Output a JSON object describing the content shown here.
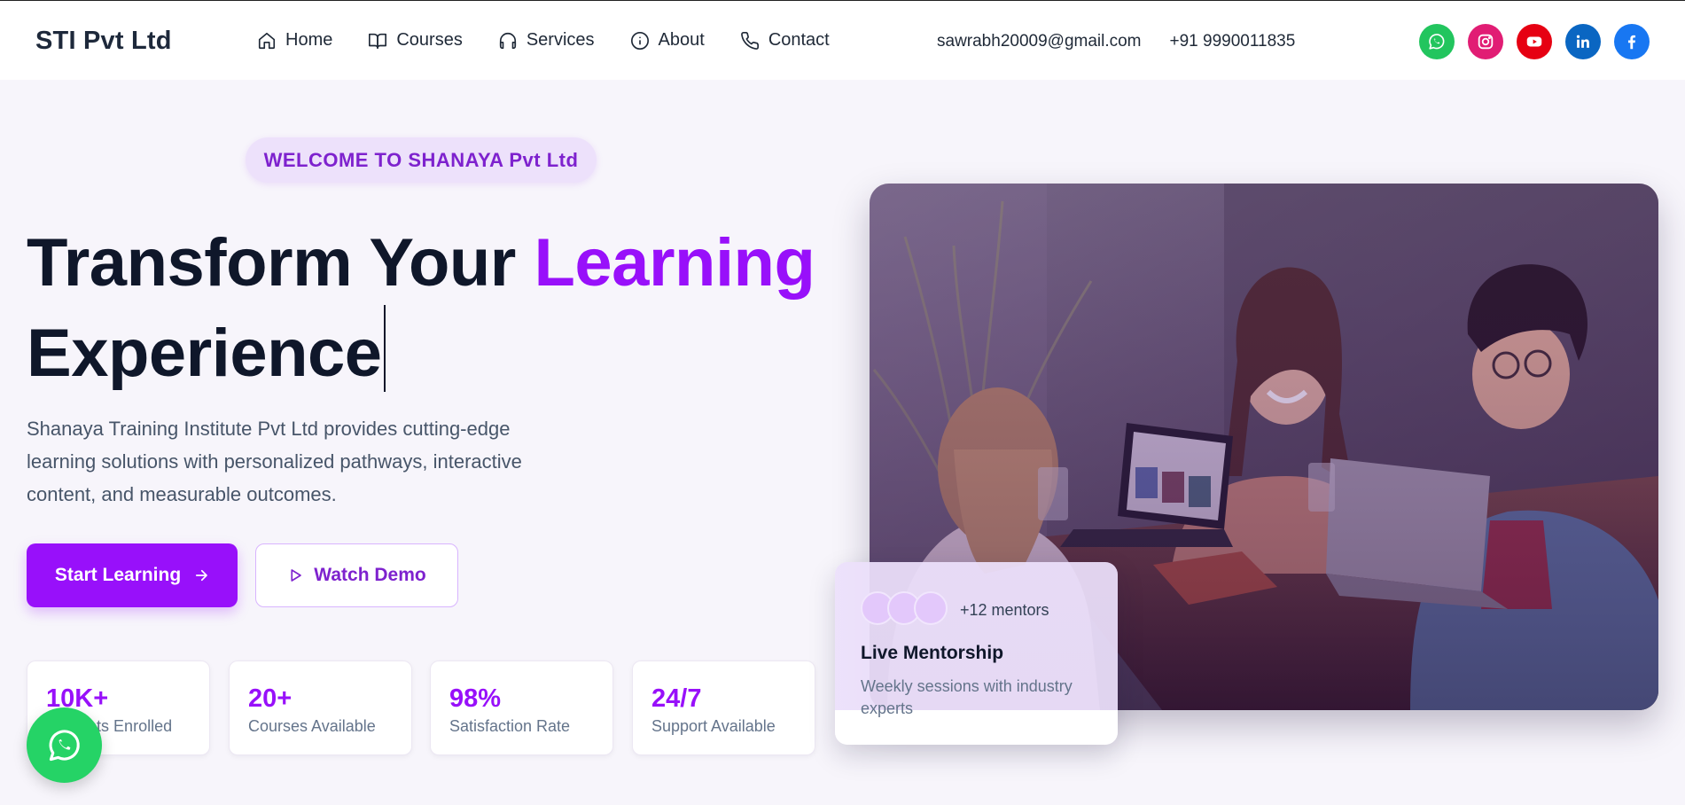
{
  "brand": "STI Pvt Ltd",
  "nav": [
    {
      "label": "Home",
      "icon": "home-icon"
    },
    {
      "label": "Courses",
      "icon": "book-icon"
    },
    {
      "label": "Services",
      "icon": "headphones-icon"
    },
    {
      "label": "About",
      "icon": "info-icon"
    },
    {
      "label": "Contact",
      "icon": "phone-icon"
    }
  ],
  "contact": {
    "email": "sawrabh20009@gmail.com",
    "phone": "+91 9990011835"
  },
  "socials": [
    {
      "name": "whatsapp",
      "color": "#22c55e"
    },
    {
      "name": "instagram",
      "color": "#e11d74"
    },
    {
      "name": "youtube",
      "color": "#e60012"
    },
    {
      "name": "linkedin",
      "color": "#0a66c2"
    },
    {
      "name": "facebook",
      "color": "#1877f2"
    }
  ],
  "hero": {
    "badge": "WELCOME TO SHANAYA Pvt Ltd",
    "headline_part1": "Transform Your ",
    "headline_accent": "Learning",
    "headline_part2": "Experience",
    "description": "Shanaya Training Institute Pvt Ltd provides cutting-edge learning solutions with personalized pathways, interactive content, and measurable outcomes.",
    "primary_button": "Start Learning",
    "secondary_button": "Watch Demo"
  },
  "stats": [
    {
      "value": "10K+",
      "label": "Students Enrolled"
    },
    {
      "value": "20+",
      "label": "Courses Available"
    },
    {
      "value": "98%",
      "label": "Satisfaction Rate"
    },
    {
      "value": "24/7",
      "label": "Support Available"
    }
  ],
  "mentor_card": {
    "count": "+12 mentors",
    "title": "Live Mentorship",
    "description": "Weekly sessions with industry experts"
  },
  "colors": {
    "accent": "#9810fa",
    "whatsapp_float": "#25d366"
  }
}
